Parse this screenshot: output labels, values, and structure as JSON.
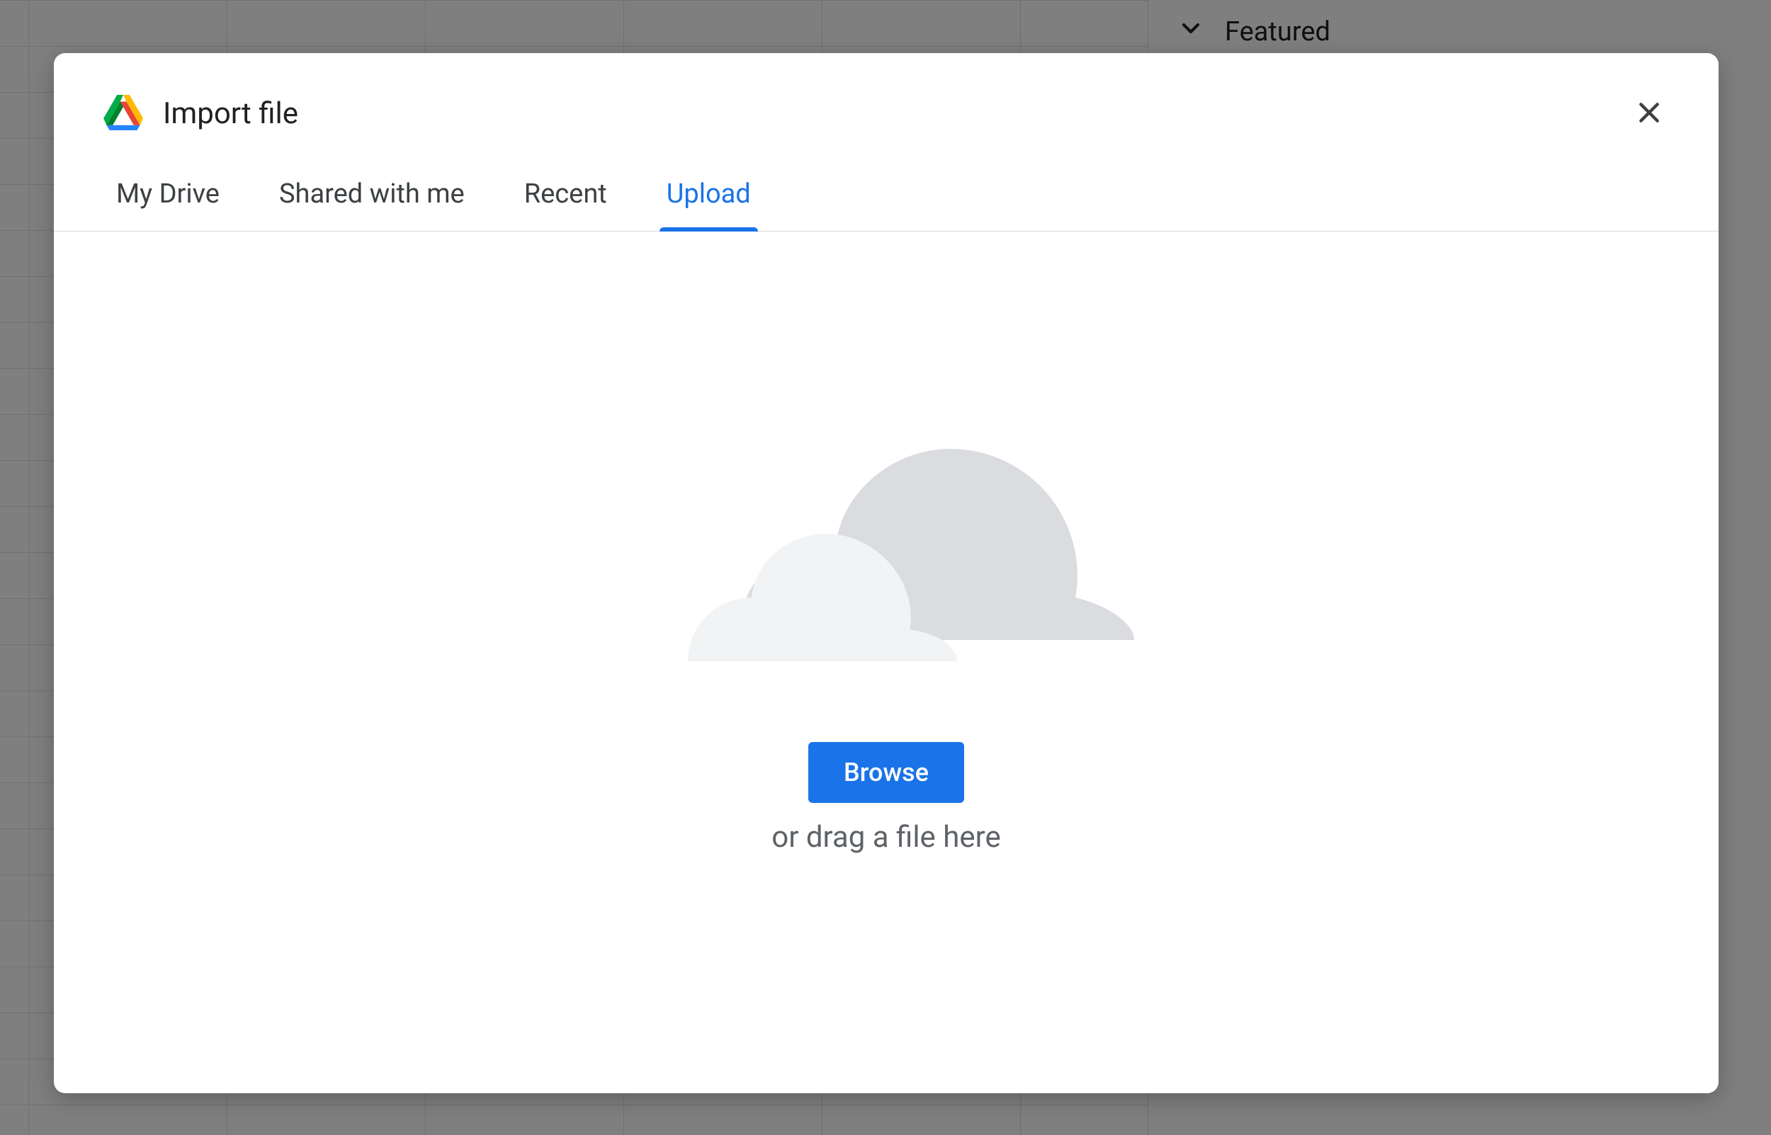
{
  "sidebar": {
    "featured_label": "Featured"
  },
  "dialog": {
    "title": "Import file",
    "tabs": [
      {
        "label": "My Drive",
        "active": false
      },
      {
        "label": "Shared with me",
        "active": false
      },
      {
        "label": "Recent",
        "active": false
      },
      {
        "label": "Upload",
        "active": true
      }
    ],
    "upload": {
      "browse_label": "Browse",
      "drag_text": "or drag a file here"
    }
  },
  "colors": {
    "primary": "#1a73e8",
    "text": "#202124",
    "muted": "#5f6368",
    "border": "#dadce0"
  }
}
